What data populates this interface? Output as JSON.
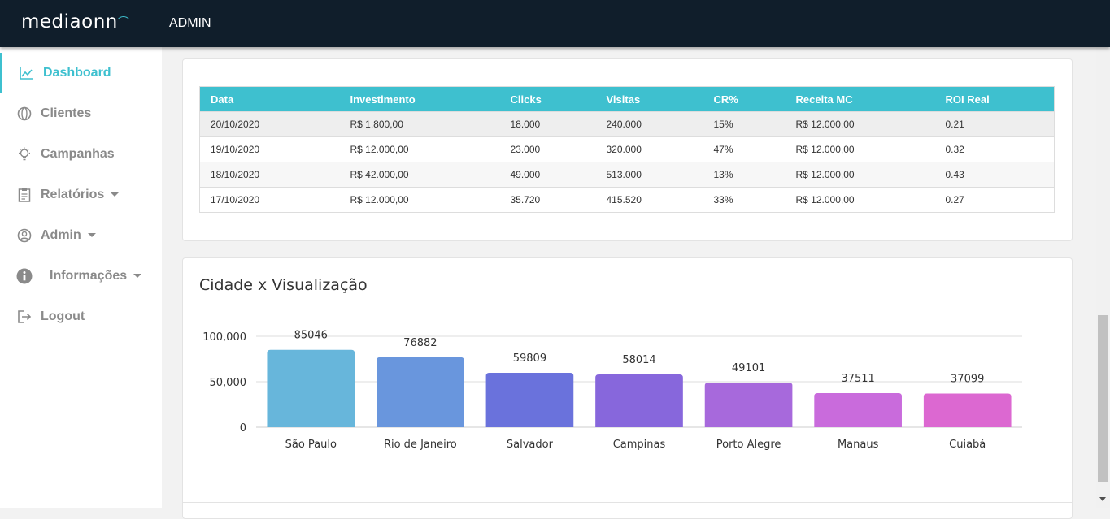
{
  "header": {
    "logo_text": "mediaonn",
    "section_label": "ADMIN"
  },
  "colors": {
    "topbar": "#101e2b",
    "accent": "#3ec0cf",
    "muted": "#8a8a8a"
  },
  "sidebar": {
    "items": [
      {
        "label": "Dashboard",
        "icon": "chart-line-icon",
        "active": true
      },
      {
        "label": "Clientes",
        "icon": "globe-icon",
        "active": false
      },
      {
        "label": "Campanhas",
        "icon": "lightbulb-icon",
        "active": false
      },
      {
        "label": "Relatórios",
        "icon": "clipboard-icon",
        "active": false,
        "dropdown": true
      },
      {
        "label": "Admin",
        "icon": "user-circle-icon",
        "active": false,
        "dropdown": true
      },
      {
        "label": "Informações",
        "icon": "info-icon",
        "active": false,
        "dropdown": true
      },
      {
        "label": "Logout",
        "icon": "logout-icon",
        "active": false
      }
    ]
  },
  "report_table": {
    "headers": [
      "Data",
      "Investimento",
      "Clicks",
      "Visitas",
      "CR%",
      "Receita MC",
      "ROI Real"
    ],
    "rows": [
      [
        "20/10/2020",
        "R$ 1.800,00",
        "18.000",
        "240.000",
        "15%",
        "R$ 12.000,00",
        "0.21"
      ],
      [
        "19/10/2020",
        "R$ 12.000,00",
        "23.000",
        "320.000",
        "47%",
        "R$ 12.000,00",
        "0.32"
      ],
      [
        "18/10/2020",
        "R$ 42.000,00",
        "49.000",
        "513.000",
        "13%",
        "R$ 12.000,00",
        "0.43"
      ],
      [
        "17/10/2020",
        "R$ 12.000,00",
        "35.720",
        "415.520",
        "33%",
        "R$ 12.000,00",
        "0.27"
      ]
    ]
  },
  "chart_card": {
    "title": "Cidade x Visualização"
  },
  "chart_data": {
    "type": "bar",
    "title": "Cidade x Visualização",
    "xlabel": "",
    "ylabel": "",
    "categories": [
      "São Paulo",
      "Rio de Janeiro",
      "Salvador",
      "Campinas",
      "Porto Alegre",
      "Manaus",
      "Cuiabá"
    ],
    "values": [
      85046,
      76882,
      59809,
      58014,
      49101,
      37511,
      37099
    ],
    "colors": [
      "#67b6db",
      "#6996dd",
      "#6a72dc",
      "#8767dc",
      "#a769dc",
      "#c96bdc",
      "#dc68d1"
    ],
    "yticks": [
      "0",
      "50,000",
      "100,000"
    ],
    "ylim": [
      0,
      100000
    ],
    "grid": true,
    "legend": "none"
  }
}
